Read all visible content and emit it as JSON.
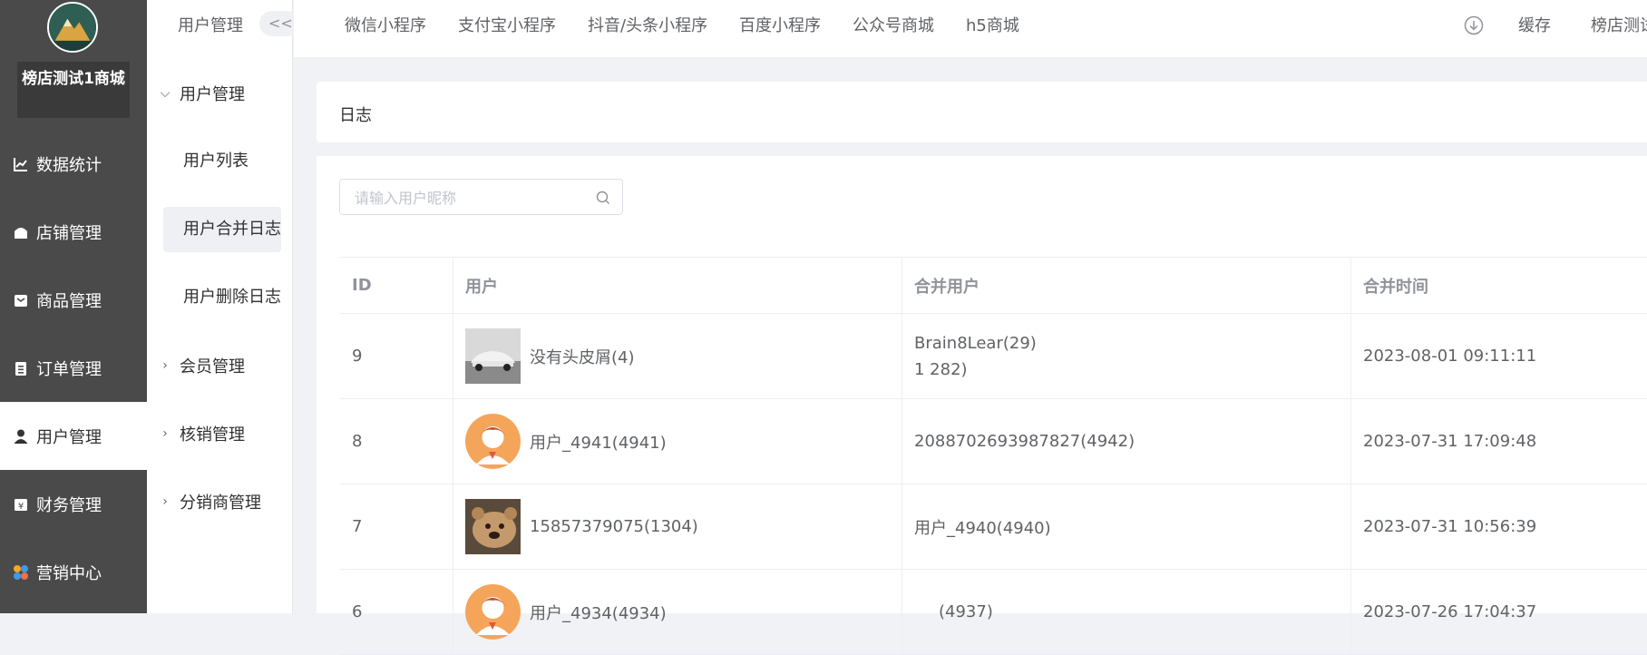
{
  "app": {
    "store_name": "榜店测试1商城"
  },
  "sidebar": {
    "items": [
      {
        "label": "数据统计",
        "icon": "chart-icon"
      },
      {
        "label": "店铺管理",
        "icon": "store-icon"
      },
      {
        "label": "商品管理",
        "icon": "goods-icon"
      },
      {
        "label": "订单管理",
        "icon": "order-icon"
      },
      {
        "label": "用户管理",
        "icon": "user-icon",
        "active": true
      },
      {
        "label": "财务管理",
        "icon": "finance-icon"
      },
      {
        "label": "营销中心",
        "icon": "marketing-icon"
      }
    ]
  },
  "subnav": {
    "title": "用户管理",
    "collapse_label": "<<",
    "groups": [
      {
        "label": "用户管理",
        "expanded": true,
        "children": [
          "用户列表",
          "用户合并日志",
          "用户删除日志"
        ]
      },
      {
        "label": "会员管理",
        "expanded": false
      },
      {
        "label": "核销管理",
        "expanded": false
      },
      {
        "label": "分销商管理",
        "expanded": false
      }
    ],
    "active_child": "用户合并日志"
  },
  "topbar": {
    "tabs": [
      "微信小程序",
      "支付宝小程序",
      "抖音/头条小程序",
      "百度小程序",
      "公众号商城",
      "h5商城"
    ],
    "cache_label": "缓存",
    "store_label": "榜店测试"
  },
  "page": {
    "card_title": "日志",
    "search_placeholder": "请输入用户昵称"
  },
  "table": {
    "headers": [
      "ID",
      "用户",
      "合并用户",
      "合并时间"
    ],
    "rows": [
      {
        "id": "9",
        "user": "没有头皮屑(4)",
        "avatar": "car",
        "merged": [
          "Brain8Lear(29)",
          "1                  282)"
        ],
        "time": "2023-08-01 09:11:11"
      },
      {
        "id": "8",
        "user": "用户_4941(4941)",
        "avatar": "default",
        "merged": [
          "2088702693987827(4942)"
        ],
        "time": "2023-07-31 17:09:48"
      },
      {
        "id": "7",
        "user": "15857379075(1304)",
        "avatar": "bear",
        "merged": [
          "用户_4940(4940)"
        ],
        "time": "2023-07-31 10:56:39"
      },
      {
        "id": "6",
        "user": "用户_4934(4934)",
        "avatar": "default",
        "merged": [
          "(4937)"
        ],
        "time": "2023-07-26 17:04:37"
      }
    ]
  },
  "colors": {
    "sidebar_bg": "#4a4a4a",
    "active_bg": "#ffffff",
    "avatar_orange": "#f5a55a"
  }
}
